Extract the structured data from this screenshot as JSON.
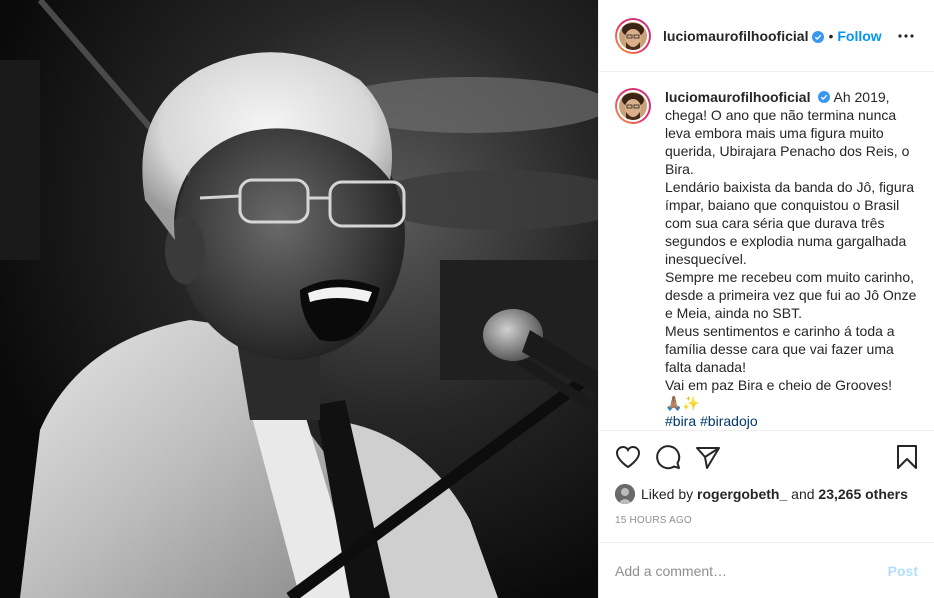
{
  "post": {
    "username": "luciomaurofilhooficial",
    "follow_label": "Follow",
    "caption_lines": [
      "Ah 2019, chega! O ano que não termina nunca leva embora mais uma figura muito querida, Ubirajara Penacho dos Reis, o Bira.",
      "Lendário baixista da banda do Jô, figura ímpar, baiano que conquistou o Brasil com sua cara séria que durava três segundos e explodia numa gargalhada inesquecível.",
      "Sempre me recebeu com muito carinho, desde a primeira vez que fui ao Jô Onze e Meia, ainda no SBT.",
      "Meus sentimentos e carinho á toda a família desse cara que vai fazer uma falta danada!",
      "Vai em paz Bira e cheio de Grooves!",
      "🙏🏽✨"
    ],
    "hashtags": "#bira #biradojo",
    "liked_by_prefix": "Liked by",
    "liked_by_user": "rogergobeth_",
    "liked_by_and": "and",
    "liked_by_count": "23,265 others",
    "timestamp": "15 HOURS AGO",
    "comment_placeholder": "Add a comment…",
    "post_label": "Post"
  },
  "icons": {
    "like": "heart-icon",
    "comment": "comment-bubble-icon",
    "share": "paper-plane-icon",
    "save": "bookmark-icon",
    "more": "more-options-icon",
    "verified": "verified-badge-icon"
  },
  "colors": {
    "accent": "#0095f6",
    "hashtag": "#00376b",
    "muted": "#8e8e8e",
    "post_disabled": "#b2dffc",
    "verified": "#3897f0"
  }
}
